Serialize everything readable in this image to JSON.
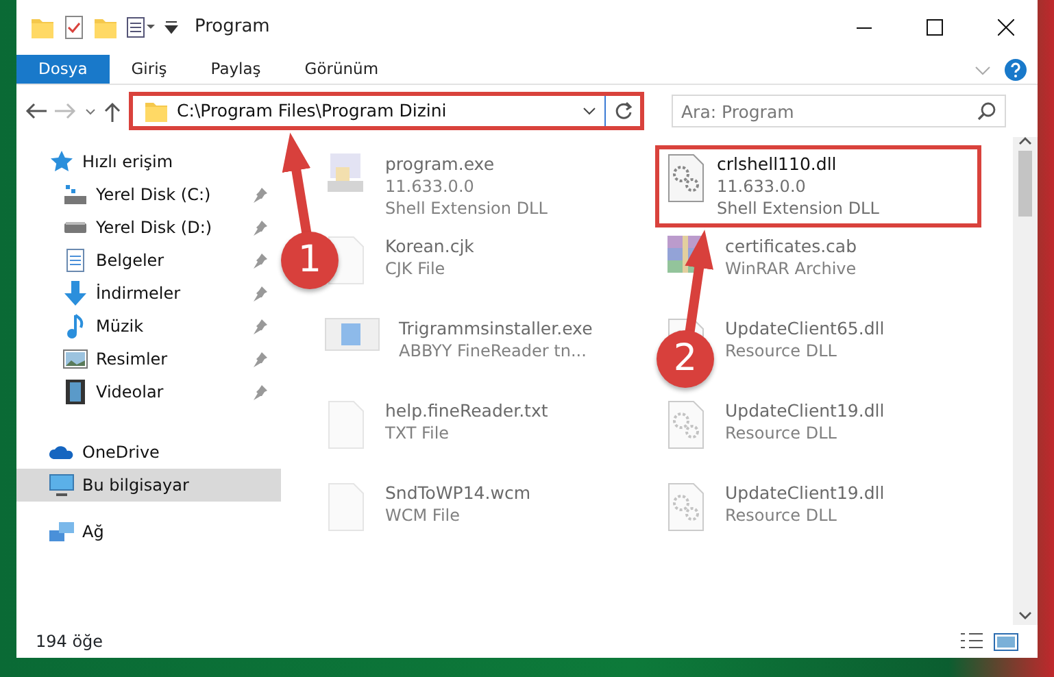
{
  "window": {
    "title": "Program"
  },
  "ribbon_tabs": [
    {
      "label": "Dosya",
      "selected": true
    },
    {
      "label": "Giriş",
      "selected": false
    },
    {
      "label": "Paylaş",
      "selected": false
    },
    {
      "label": "Görünüm",
      "selected": false
    }
  ],
  "address_bar": {
    "path": "C:\\Program Files\\Program Dizini",
    "highlighted": true
  },
  "search": {
    "placeholder": "Ara: Program"
  },
  "sidebar": {
    "items": [
      {
        "label": "Hızlı erişim",
        "kind": "star",
        "pinned": false,
        "selected": false
      },
      {
        "label": "Yerel Disk (C:)",
        "kind": "drive-c",
        "pinned": true,
        "selected": false
      },
      {
        "label": "Yerel Disk (D:)",
        "kind": "drive",
        "pinned": true,
        "selected": false
      },
      {
        "label": "Belgeler",
        "kind": "documents",
        "pinned": true,
        "selected": false
      },
      {
        "label": "İndirmeler",
        "kind": "downloads",
        "pinned": true,
        "selected": false
      },
      {
        "label": "Müzik",
        "kind": "music",
        "pinned": true,
        "selected": false
      },
      {
        "label": "Resimler",
        "kind": "pictures",
        "pinned": true,
        "selected": false
      },
      {
        "label": "Videolar",
        "kind": "videos",
        "pinned": true,
        "selected": false
      },
      {
        "label": "OneDrive",
        "kind": "cloud",
        "pinned": false,
        "selected": false
      },
      {
        "label": "Bu bilgisayar",
        "kind": "computer",
        "pinned": false,
        "selected": true
      },
      {
        "label": "Ağ",
        "kind": "network",
        "pinned": false,
        "selected": false
      }
    ]
  },
  "files": [
    {
      "name": "program.exe",
      "details": [
        "11.633.0.0",
        "Shell Extension DLL"
      ],
      "kind": "app",
      "blurred": true,
      "highlighted": false
    },
    {
      "name": "crlshell110.dll",
      "details": [
        "11.633.0.0",
        "Shell Extension DLL"
      ],
      "kind": "dll",
      "blurred": false,
      "highlighted": true
    },
    {
      "name": "Korean.cjk",
      "details": [
        "CJK File"
      ],
      "kind": "blank",
      "blurred": true,
      "highlighted": false
    },
    {
      "name": "certificates.cab",
      "details": [
        "WinRAR Archive"
      ],
      "kind": "archive",
      "blurred": true,
      "highlighted": false
    },
    {
      "name": "Trigrammsinstaller.exe",
      "details": [
        "ABBYY FineReader tn..."
      ],
      "kind": "window",
      "blurred": true,
      "highlighted": false
    },
    {
      "name": "UpdateClient65.dll",
      "details": [
        "Resource DLL"
      ],
      "kind": "dll",
      "blurred": true,
      "highlighted": false
    },
    {
      "name": "help.fineReader.txt",
      "details": [
        "TXT File"
      ],
      "kind": "blank",
      "blurred": true,
      "highlighted": false
    },
    {
      "name": "UpdateClient19.dll",
      "details": [
        "Resource DLL"
      ],
      "kind": "dll",
      "blurred": true,
      "highlighted": false
    },
    {
      "name": "SndToWP14.wcm",
      "details": [
        "WCM File"
      ],
      "kind": "blank",
      "blurred": true,
      "highlighted": false
    },
    {
      "name": "UpdateClient19.dll",
      "details": [
        "Resource DLL"
      ],
      "kind": "dll",
      "blurred": true,
      "highlighted": false
    }
  ],
  "status_bar": {
    "count": "194 öğe"
  },
  "annotations": [
    {
      "number": "1"
    },
    {
      "number": "2"
    }
  ]
}
